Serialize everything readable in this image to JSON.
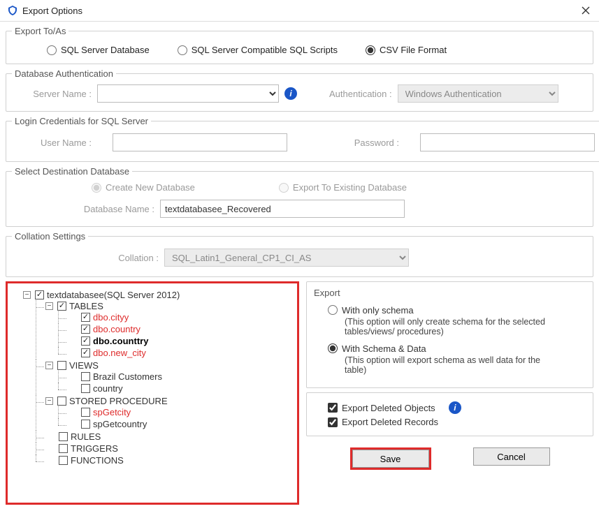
{
  "window": {
    "title": "Export Options"
  },
  "exportTo": {
    "legend": "Export To/As",
    "sqlDb": "SQL Server Database",
    "sqlScripts": "SQL Server Compatible SQL Scripts",
    "csv": "CSV File Format",
    "selected": "csv"
  },
  "dbAuth": {
    "legend": "Database Authentication",
    "serverNameLabel": "Server Name :",
    "serverName": "",
    "authLabel": "Authentication :",
    "authValue": "Windows Authentication"
  },
  "login": {
    "legend": "Login Credentials for SQL Server",
    "userLabel": "User Name :",
    "userValue": "",
    "passLabel": "Password :",
    "passValue": ""
  },
  "dest": {
    "legend": "Select Destination Database",
    "createNew": "Create New Database",
    "exportExisting": "Export To Existing Database",
    "dbNameLabel": "Database Name :",
    "dbNameValue": "textdatabasee_Recovered"
  },
  "collation": {
    "legend": "Collation Settings",
    "label": "Collation :",
    "value": "SQL_Latin1_General_CP1_CI_AS"
  },
  "tree": {
    "root": "textdatabasee(SQL Server 2012)",
    "tables": "TABLES",
    "tablesItems": [
      "dbo.cityy",
      "dbo.country",
      "dbo.counttry",
      "dbo.new_city"
    ],
    "views": "VIEWS",
    "viewsItems": [
      "Brazil Customers",
      "country"
    ],
    "sp": "STORED PROCEDURE",
    "spItems": [
      "spGetcity",
      "spGetcountry"
    ],
    "rules": "RULES",
    "triggers": "TRIGGERS",
    "functions": "FUNCTIONS"
  },
  "export": {
    "title": "Export",
    "schemaOnly": "With only schema",
    "schemaOnlyHint": "(This option will only create schema for the  selected tables/views/ procedures)",
    "schemaData": "With Schema & Data",
    "schemaDataHint": "(This option will export schema as well data for the table)",
    "delObjects": "Export Deleted Objects",
    "delRecords": "Export Deleted Records"
  },
  "buttons": {
    "save": "Save",
    "cancel": "Cancel"
  }
}
